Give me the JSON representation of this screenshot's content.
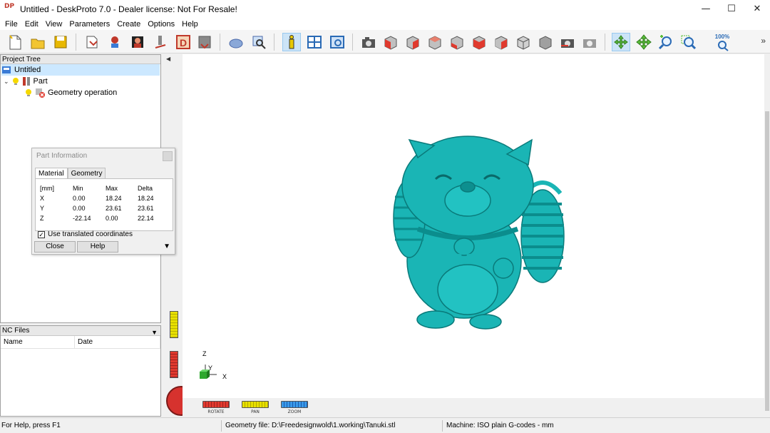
{
  "window": {
    "title": "Untitled - DeskProto 7.0 - Dealer license: Not For Resale!",
    "logo_text": "DP"
  },
  "menu": {
    "items": [
      "File",
      "Edit",
      "View",
      "Parameters",
      "Create",
      "Options",
      "Help"
    ]
  },
  "toolbar": {
    "zoom_label": "100%",
    "groups": [
      [
        "new-file",
        "open-folder",
        "save-disk"
      ],
      [
        "import-geometry",
        "part-transform",
        "bitmap-part",
        "mill-tool",
        "drawing-d",
        "save-nc"
      ],
      [
        "object-shape",
        "object-search"
      ],
      [
        "info",
        "window-layout",
        "view-window"
      ],
      [
        "camera-view",
        "view-front-red",
        "view-right-red",
        "view-back",
        "view-left",
        "view-top-red",
        "view-bottom-red",
        "view-iso",
        "view-iso-gray",
        "camera-snapshot",
        "camera-settings"
      ],
      [
        "rotate-tool",
        "pan-tool",
        "zoom-in-tool",
        "zoom-window-tool",
        "zoom-100-tool"
      ]
    ]
  },
  "project_tree": {
    "header": "Project Tree",
    "root": "Untitled",
    "part": "Part",
    "operation": "Geometry operation"
  },
  "part_info": {
    "title": "Part Information",
    "tabs": [
      "Material",
      "Geometry"
    ],
    "columns": [
      "[mm]",
      "Min",
      "Max",
      "Delta"
    ],
    "rows": [
      {
        "axis": "X",
        "min": "0.00",
        "max": "18.24",
        "delta": "18.24"
      },
      {
        "axis": "Y",
        "min": "0.00",
        "max": "23.61",
        "delta": "23.61"
      },
      {
        "axis": "Z",
        "min": "-22.14",
        "max": "0.00",
        "delta": "22.14"
      }
    ],
    "checkbox_label": "Use translated coordinates",
    "checkbox_checked": true,
    "close_label": "Close",
    "help_label": "Help"
  },
  "nc_files": {
    "header": "NC Files",
    "columns": [
      "Name",
      "Date"
    ]
  },
  "viewport": {
    "axis_z": "Z",
    "axis_y": "Y",
    "axis_x": "X",
    "nav": {
      "rotate": "ROTATE",
      "pan": "PAN",
      "zoom": "ZOOM"
    },
    "model_color": "#1ab5b5"
  },
  "statusbar": {
    "help": "For Help, press F1",
    "geometry": "Geometry file: D:\\Freedesignwold\\1.working\\Tanuki.stl",
    "machine": "Machine: ISO plain G-codes - mm"
  }
}
